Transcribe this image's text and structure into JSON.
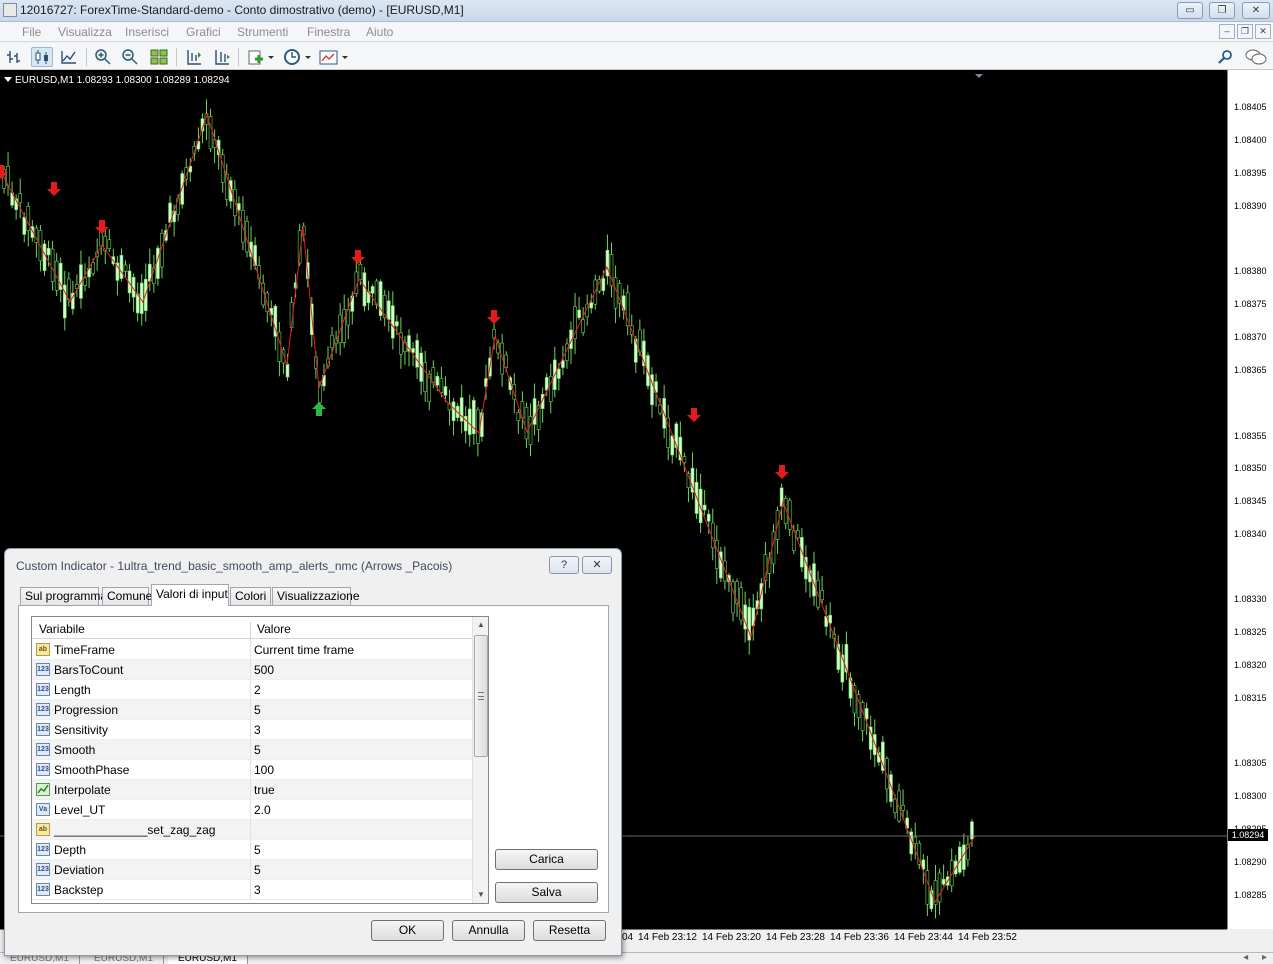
{
  "window": {
    "title": "12016727: ForexTime-Standard-demo - Conto dimostrativo (demo) - [EURUSD,M1]",
    "minimize_glyph": "▭",
    "maximize_glyph": "❐",
    "close_glyph": "✕"
  },
  "menu": [
    "File",
    "Visualizza",
    "Inserisci",
    "Grafici",
    "Strumenti",
    "Finestra",
    "Aiuto"
  ],
  "mdi_controls": [
    "–",
    "❐",
    "✕"
  ],
  "toolbar": {
    "icons": [
      "bar-chart-icon",
      "candlestick-chart-icon",
      "line-chart-icon",
      "zoom-in-icon",
      "zoom-out-icon",
      "tile-windows-icon",
      "chart-shift-icon",
      "autoscroll-icon",
      "indicators-icon",
      "periods-icon",
      "templates-icon",
      "search-icon",
      "chat-icon"
    ]
  },
  "chart": {
    "symbol_info": "EURUSD,M1  1.08293 1.08300 1.08289 1.08294",
    "price_labels": [
      "1.08405",
      "1.08400",
      "1.08395",
      "1.08390",
      "1.08380",
      "1.08375",
      "1.08370",
      "1.08365",
      "1.08355",
      "1.08350",
      "1.08345",
      "1.08340",
      "1.08330",
      "1.08325",
      "1.08320",
      "1.08315",
      "1.08305",
      "1.08300",
      "1.08295",
      "1.08290",
      "1.08285"
    ],
    "current_price": "1.08294",
    "time_labels": [
      "04",
      "14 Feb 23:12",
      "14 Feb 23:20",
      "14 Feb 23:28",
      "14 Feb 23:36",
      "14 Feb 23:44",
      "14 Feb 23:52"
    ],
    "colors": {
      "background": "#000000",
      "bull": "#ccffcc",
      "wick": "#6fd35a",
      "zigzag": "#e02020",
      "sell_arrow": "#e21b1b",
      "buy_arrow": "#2db84c"
    }
  },
  "chart_tabs": [
    "EURUSD,M1",
    "EURUSD,M1",
    "EURUSD,M1"
  ],
  "dialog": {
    "title": "Custom Indicator - 1ultra_trend_basic_smooth_amp_alerts_nmc (Arrows _Pacois)",
    "help": "?",
    "close": "✕",
    "tabs": [
      "Sul programma",
      "Comune",
      "Valori di input",
      "Colori",
      "Visualizzazione"
    ],
    "active_tab": "Valori di input",
    "columns": [
      "Variabile",
      "Valore"
    ],
    "rows": [
      {
        "type": "ab",
        "name": "TimeFrame",
        "value": "Current time frame"
      },
      {
        "type": "123",
        "name": "BarsToCount",
        "value": "500"
      },
      {
        "type": "123",
        "name": "Length",
        "value": "2"
      },
      {
        "type": "123",
        "name": "Progression",
        "value": "5"
      },
      {
        "type": "123",
        "name": "Sensitivity",
        "value": "3"
      },
      {
        "type": "123",
        "name": "Smooth",
        "value": "5"
      },
      {
        "type": "123",
        "name": "SmoothPhase",
        "value": "100"
      },
      {
        "type": "bool",
        "name": "Interpolate",
        "value": "true"
      },
      {
        "type": "dbl",
        "name": "Level_UT",
        "value": "2.0"
      },
      {
        "type": "ab",
        "name": "______________set_zag_zag",
        "value": ""
      },
      {
        "type": "123",
        "name": "Depth",
        "value": "5"
      },
      {
        "type": "123",
        "name": "Deviation",
        "value": "5"
      },
      {
        "type": "123",
        "name": "Backstep",
        "value": "3"
      }
    ],
    "icon_labels": {
      "ab": "ab",
      "123": "123",
      "bool": "",
      "dbl": "Va"
    },
    "scroll_up": "▲",
    "scroll_down": "▼",
    "buttons": {
      "load": "Carica",
      "save": "Salva",
      "ok": "OK",
      "cancel": "Annulla",
      "reset": "Resetta"
    }
  }
}
